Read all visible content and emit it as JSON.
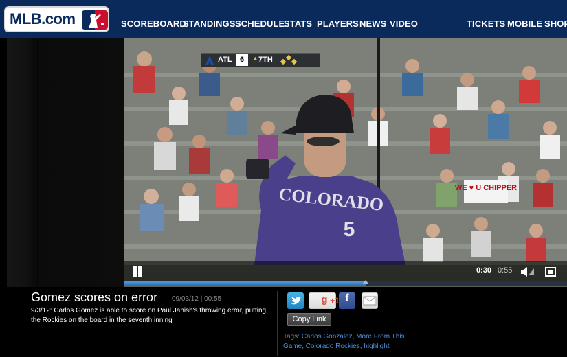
{
  "header": {
    "logo_text": "MLB.com",
    "nav": [
      "SCOREBOARD",
      "STANDINGS",
      "SCHEDULE",
      "STATS",
      "PLAYERS",
      "NEWS",
      "VIDEO"
    ],
    "nav_right": [
      "TICKETS",
      "MOBILE",
      "SHOP"
    ]
  },
  "player_video": {
    "scorebug": {
      "team": "ATL",
      "score": "6",
      "inning": "7TH"
    },
    "jersey_text": "COLORADO",
    "jersey_number": "5",
    "sign_text": "WE ♥ U CHIPPER",
    "time_current": "0:30",
    "time_separator": "|",
    "time_total": "0:55",
    "progress_fraction": 0.545
  },
  "clip": {
    "title": "Gomez scores on error",
    "meta": "09/03/12 | 00:55",
    "description": "9/3/12: Carlos Gomez is able to score on Paul Janish's throwing error, putting the Rockies on the board in the seventh inning",
    "copy_link_label": "Copy Link",
    "gplus_label": "+1",
    "tags_label": "Tags:",
    "tags": [
      "Carlos Gonzalez",
      "More From This Game",
      "Colorado Rockies",
      "highlight"
    ]
  },
  "colors": {
    "header_bg": "#0b2a5c",
    "accent": "#2d6cb5",
    "link": "#4f8fd8"
  }
}
